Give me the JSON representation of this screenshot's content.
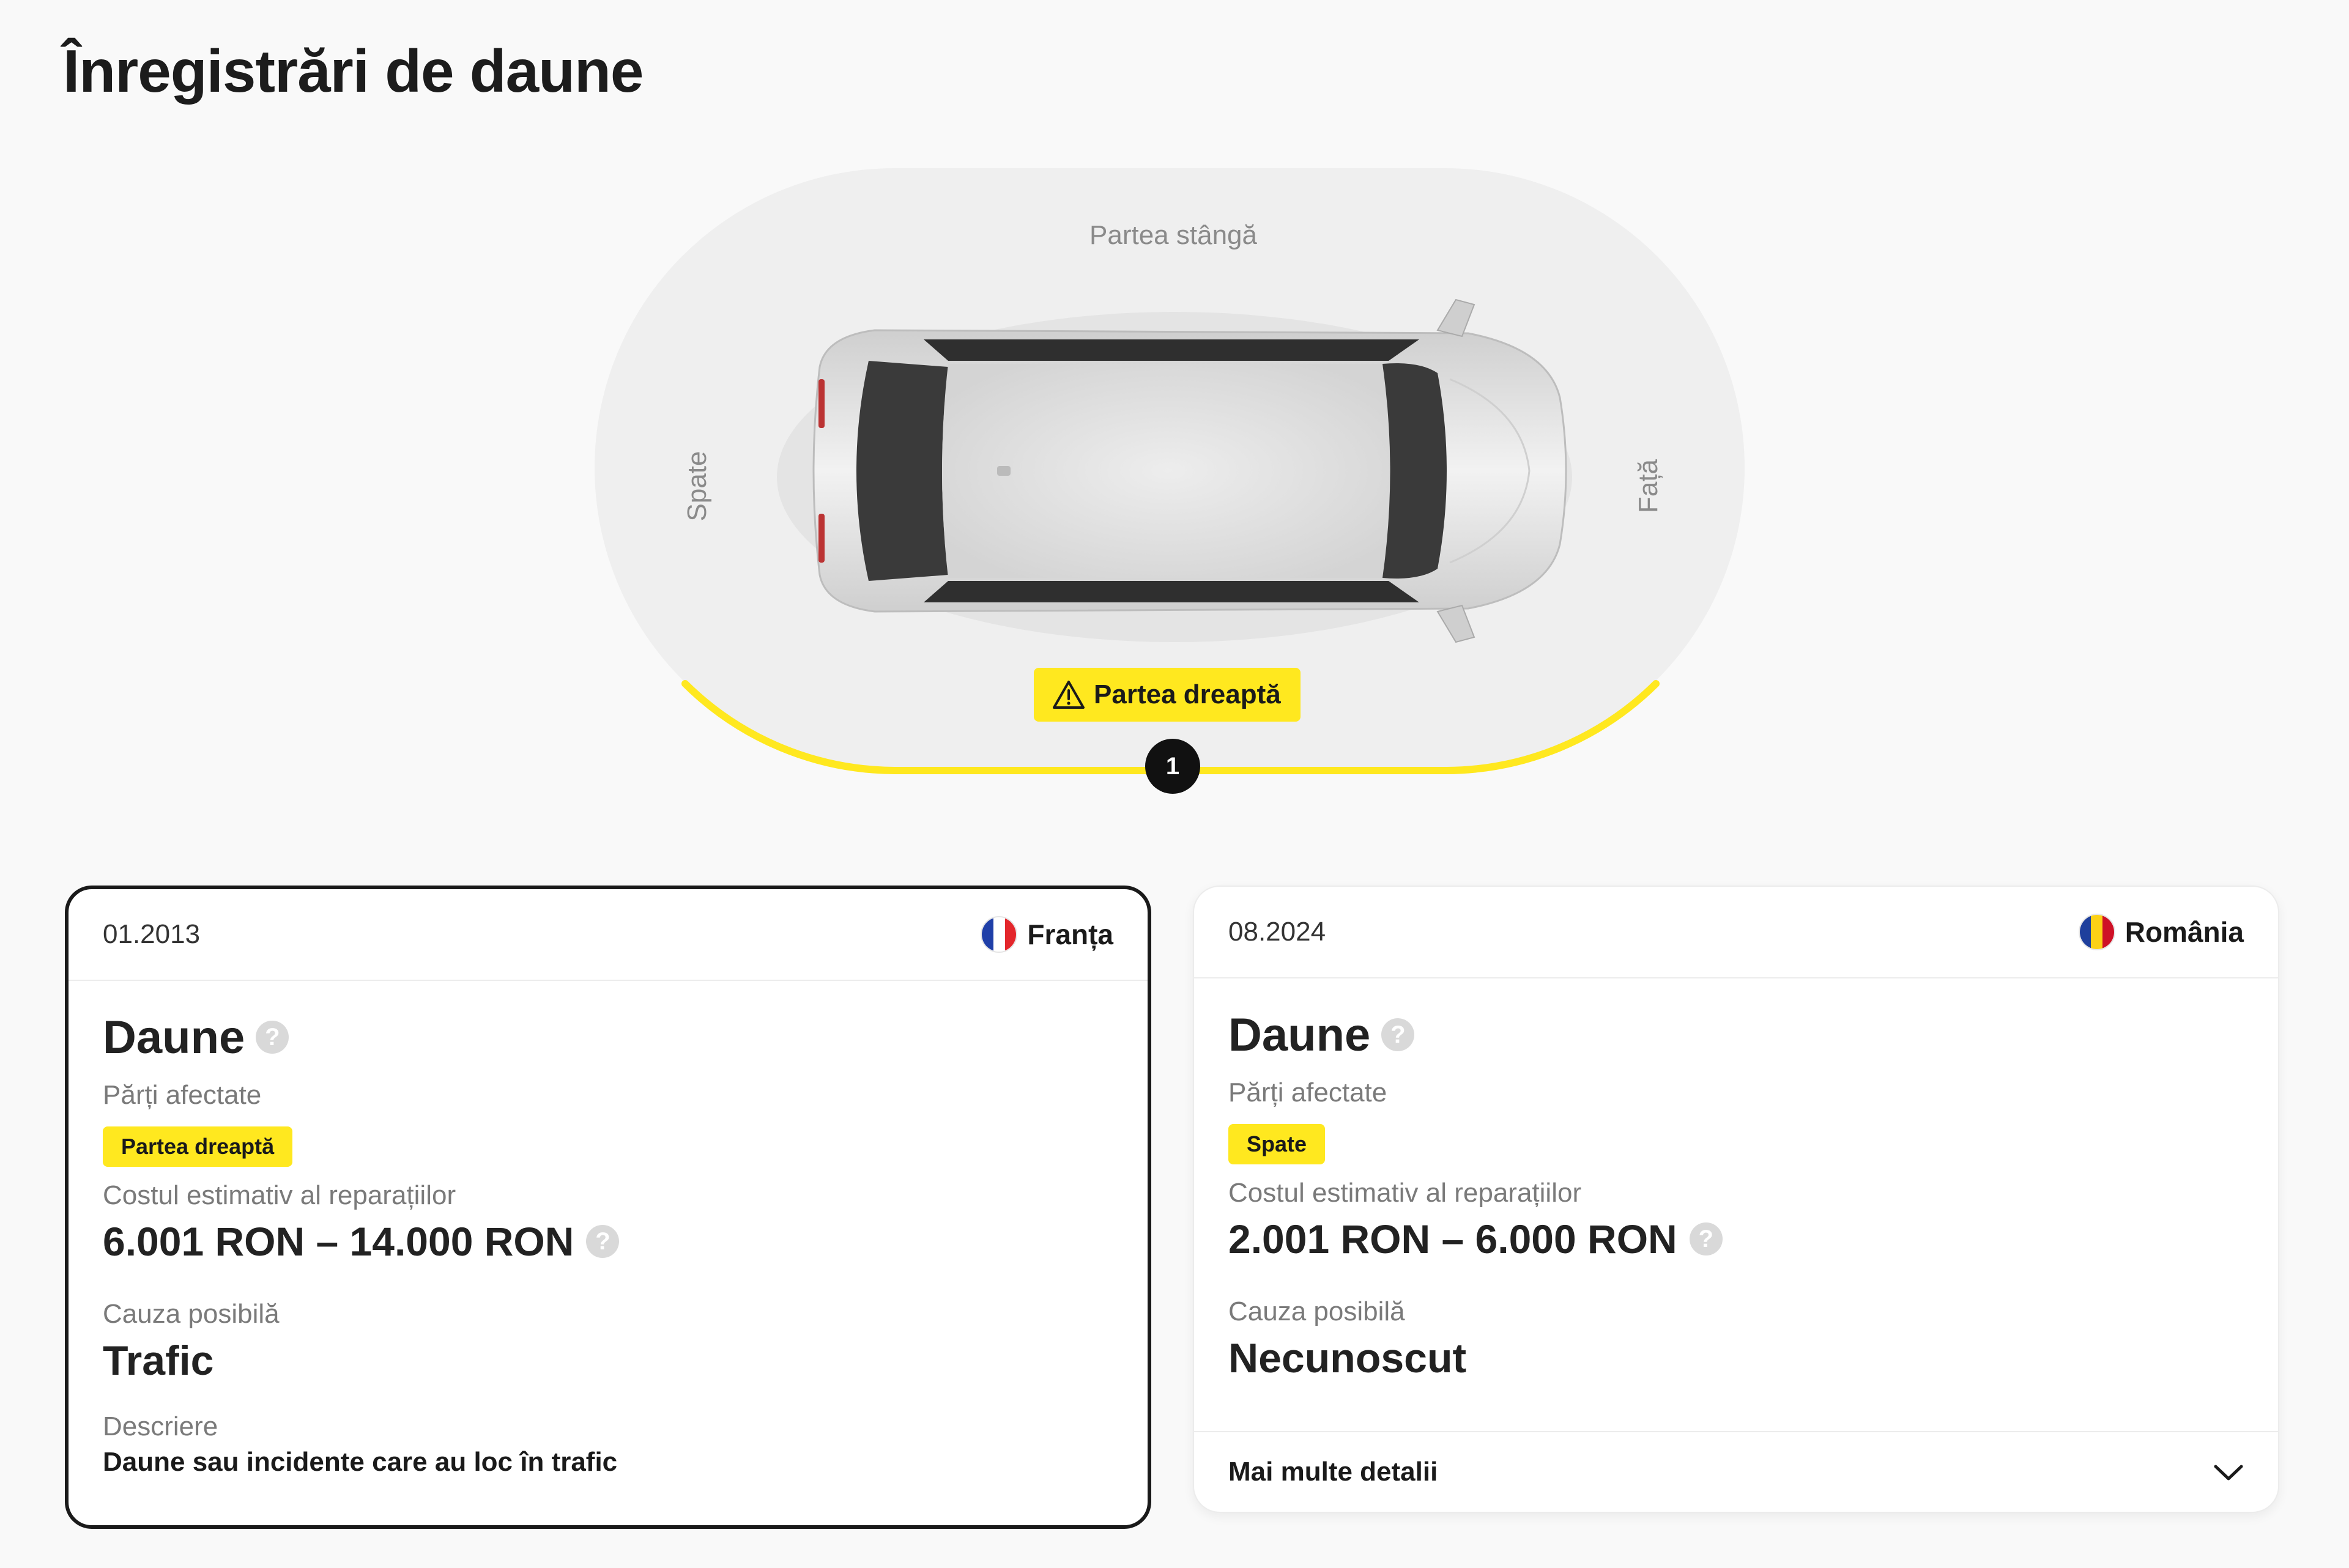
{
  "page": {
    "title": "Înregistrări de daune"
  },
  "diagram": {
    "labels": {
      "left": "Partea stângă",
      "back": "Spate",
      "front": "Față"
    },
    "highlight": {
      "side": "Partea dreaptă",
      "color": "#ffe81f"
    },
    "marker_count": "1"
  },
  "records": [
    {
      "date": "01.2013",
      "country": "Franța",
      "flag_colors": [
        "#1f3fa8",
        "#ffffff",
        "#e3262b"
      ],
      "title": "Daune",
      "affected_label": "Părți afectate",
      "affected_tag": "Partea dreaptă",
      "cost_label": "Costul estimativ al reparațiilor",
      "cost_value": "6.001 RON – 14.000 RON",
      "cause_label": "Cauza posibilă",
      "cause_value": "Trafic",
      "description_label": "Descriere",
      "description_value": "Daune sau incidente care au loc în trafic",
      "selected": true
    },
    {
      "date": "08.2024",
      "country": "România",
      "flag_colors": [
        "#1e3f9c",
        "#fcd116",
        "#ce1126"
      ],
      "title": "Daune",
      "affected_label": "Părți afectate",
      "affected_tag": "Spate",
      "cost_label": "Costul estimativ al reparațiilor",
      "cost_value": "2.001 RON – 6.000 RON",
      "cause_label": "Cauza posibilă",
      "cause_value": "Necunoscut",
      "more_details": "Mai multe detalii",
      "selected": false
    }
  ],
  "icons": {
    "help": "question-circle-icon",
    "warning": "warning-triangle-icon",
    "expand": "chevron-down-icon"
  },
  "help_glyph": "?"
}
